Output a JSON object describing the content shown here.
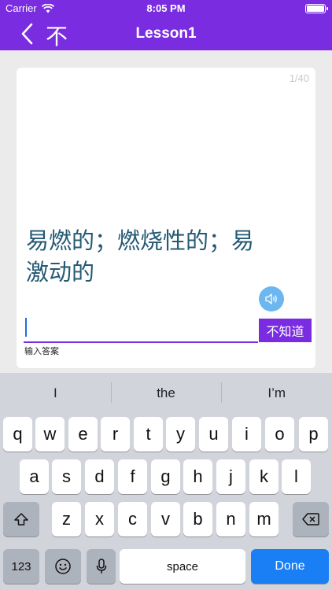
{
  "status_bar": {
    "carrier": "Carrier",
    "time": "8:05 PM"
  },
  "nav": {
    "back_char": "不",
    "title": "Lesson1"
  },
  "card": {
    "counter": "1/40",
    "question": "易燃的；燃烧性的；易激动的",
    "input_value": "",
    "dont_know_label": "不知道",
    "hint": "输入答案"
  },
  "keyboard": {
    "suggestions": [
      "I",
      "the",
      "I’m"
    ],
    "row1": [
      "q",
      "w",
      "e",
      "r",
      "t",
      "y",
      "u",
      "i",
      "o",
      "p"
    ],
    "row2": [
      "a",
      "s",
      "d",
      "f",
      "g",
      "h",
      "j",
      "k",
      "l"
    ],
    "row3": [
      "z",
      "x",
      "c",
      "v",
      "b",
      "n",
      "m"
    ],
    "numbers_label": "123",
    "space_label": "space",
    "done_label": "Done"
  },
  "colors": {
    "accent": "#7a2de0",
    "question_text": "#245a73",
    "done_key": "#1a7ef5",
    "sound_button": "#6cb7f0"
  }
}
